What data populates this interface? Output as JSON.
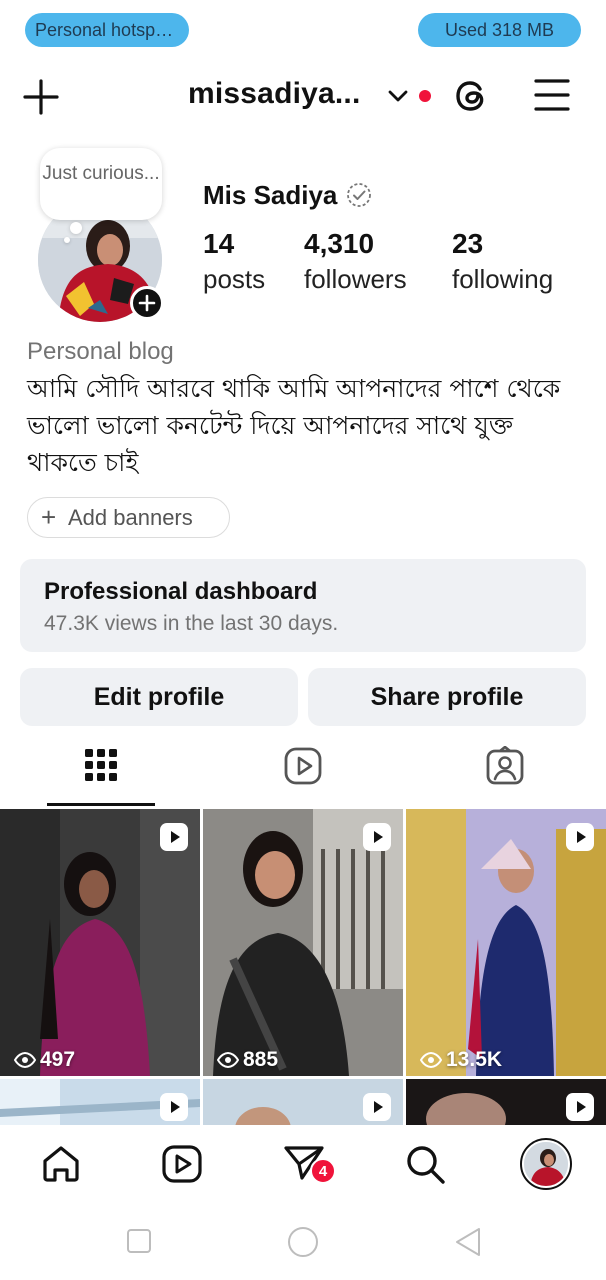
{
  "status_bar": {
    "hotspot_label": "Personal hotspot...",
    "data_used": "Used  318 MB"
  },
  "header": {
    "username": "missadiya...",
    "icons": [
      "plus-icon",
      "chevron-down-icon",
      "threads-icon",
      "menu-icon"
    ]
  },
  "profile": {
    "note": "Just curious...",
    "display_name": "Mis Sadiya",
    "stats": [
      {
        "value": "14",
        "label": "posts"
      },
      {
        "value": "4,310",
        "label": "followers"
      },
      {
        "value": "23",
        "label": "following"
      }
    ],
    "category": "Personal blog",
    "bio": "আমি সৌদি আরবে থাকি আমি আপনাদের পাশে থেকে ভালো ভালো কনটেন্ট দিয়ে আপনাদের সাথে যুক্ত থাকতে চাই",
    "add_banners_label": "Add banners"
  },
  "dashboard": {
    "title": "Professional dashboard",
    "subtitle": "47.3K views in the last 30 days."
  },
  "actions": {
    "edit_label": "Edit profile",
    "share_label": "Share profile"
  },
  "tabs": [
    "grid-icon",
    "reels-icon",
    "tagged-icon"
  ],
  "posts": [
    {
      "views": "497",
      "type": "reel"
    },
    {
      "views": "885",
      "type": "reel"
    },
    {
      "views": "13.5K",
      "type": "reel"
    },
    {
      "views": "",
      "type": "reel"
    },
    {
      "views": "",
      "type": "reel"
    },
    {
      "views": "",
      "type": "reel"
    }
  ],
  "bottom_nav": {
    "items": [
      "home-icon",
      "reels-icon",
      "messages-icon",
      "search-icon",
      "profile-avatar"
    ],
    "messages_badge": "4"
  },
  "colors": {
    "accent_pill": "#4db6ec",
    "notification_red": "#f0133a",
    "button_bg": "#eff1f4"
  }
}
